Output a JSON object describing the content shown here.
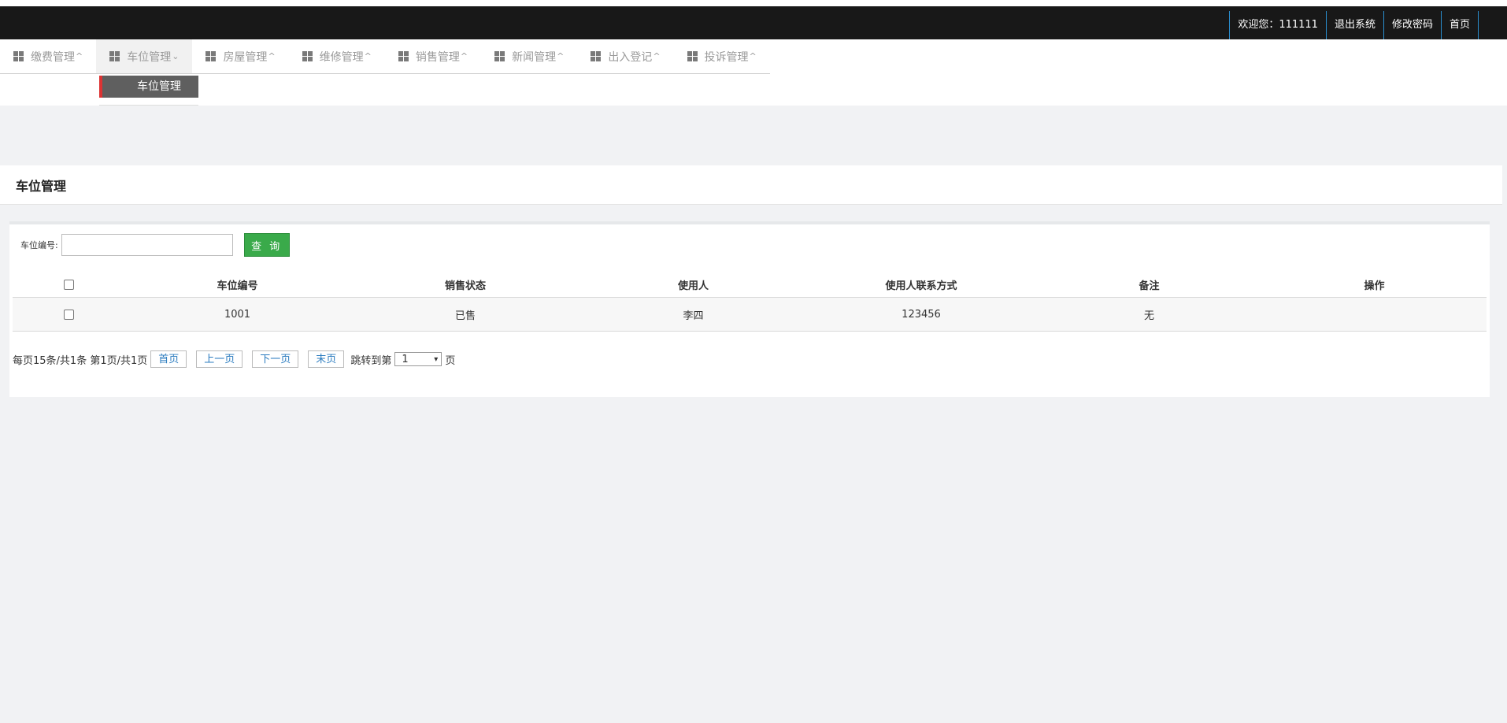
{
  "topbar": {
    "welcome": "欢迎您：111111",
    "logout": "退出系统",
    "change_password": "修改密码",
    "home": "首页"
  },
  "nav": {
    "items": [
      {
        "label": "缴费管理",
        "caret": "^"
      },
      {
        "label": "车位管理",
        "caret": "v"
      },
      {
        "label": "房屋管理",
        "caret": "^"
      },
      {
        "label": "维修管理",
        "caret": "^"
      },
      {
        "label": "销售管理",
        "caret": "^"
      },
      {
        "label": "新闻管理",
        "caret": "^"
      },
      {
        "label": "出入登记",
        "caret": "^"
      },
      {
        "label": "投诉管理",
        "caret": "^"
      }
    ],
    "submenu_item": "车位管理"
  },
  "page": {
    "title": "车位管理"
  },
  "search": {
    "label": "车位编号:",
    "value": "",
    "button": "查 询"
  },
  "table": {
    "headers": [
      "车位编号",
      "销售状态",
      "使用人",
      "使用人联系方式",
      "备注",
      "操作"
    ],
    "rows": [
      [
        "1001",
        "已售",
        "李四",
        "123456",
        "无",
        ""
      ]
    ]
  },
  "pager": {
    "summary": "每页15条/共1条 第1页/共1页",
    "first": "首页",
    "prev": "上一页",
    "next": "下一页",
    "last": "末页",
    "jump_label": "跳转到第",
    "page_select": "1",
    "page_suffix": "页"
  },
  "colors": {
    "topbar_bg": "#181818",
    "submenu_accent": "#dd3333",
    "search_button": "#3aaa4a",
    "link": "#2a7bbf"
  }
}
